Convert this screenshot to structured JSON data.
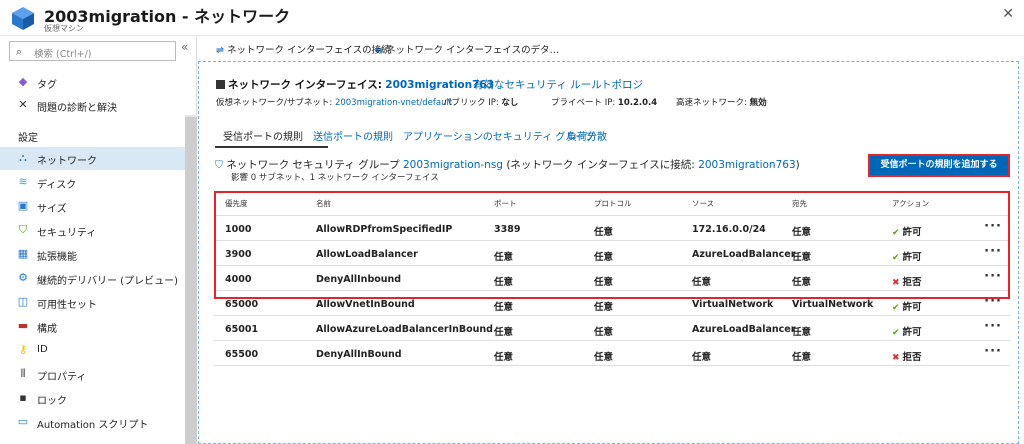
{
  "header": {
    "title": "2003migration - ネットワーク",
    "subtitle": "仮想マシン",
    "logo_icon": "vm-cube-icon",
    "close_icon": "close-icon"
  },
  "sidebar": {
    "search_placeholder": "検索 (Ctrl+/)",
    "collapse_glyph": "«",
    "section_settings": "設定",
    "top_items": [
      {
        "label": "タグ",
        "icon": "tag-icon"
      },
      {
        "label": "問題の診断と解決",
        "icon": "wrench-icon"
      }
    ],
    "items": [
      {
        "label": "ネットワーク",
        "icon": "network-icon",
        "active": true
      },
      {
        "label": "ディスク",
        "icon": "disk-icon"
      },
      {
        "label": "サイズ",
        "icon": "size-icon"
      },
      {
        "label": "セキュリティ",
        "icon": "shield-icon"
      },
      {
        "label": "拡張機能",
        "icon": "extensions-icon"
      },
      {
        "label": "継続的デリバリー (プレビュー)",
        "icon": "delivery-icon"
      },
      {
        "label": "可用性セット",
        "icon": "availability-icon"
      },
      {
        "label": "構成",
        "icon": "config-icon"
      },
      {
        "label": "ID",
        "icon": "key-icon"
      },
      {
        "label": "プロパティ",
        "icon": "properties-icon"
      },
      {
        "label": "ロック",
        "icon": "lock-icon"
      },
      {
        "label": "Automation スクリプト",
        "icon": "script-icon"
      }
    ]
  },
  "commands": [
    {
      "label": "ネットワーク インターフェイスの接続",
      "icon": "attach-icon"
    },
    {
      "label": "ネットワーク インターフェイスのデタ…",
      "icon": "detach-icon"
    }
  ],
  "interface": {
    "prefix": "ネットワーク インターフェイス:",
    "name": "2003migration763",
    "effective_rules": "有効なセキュリティ ルール",
    "topology": "トポロジ",
    "vnet_label": "仮想ネットワーク/サブネット:",
    "vnet_value": "2003migration-vnet/default",
    "public_ip_label": "パブリック IP:",
    "public_ip_value": "なし",
    "private_ip_label": "プライベート IP:",
    "private_ip_value": "10.2.0.4",
    "accel_label": "高速ネットワーク:",
    "accel_value": "無効"
  },
  "tabs": [
    {
      "label": "受信ポートの規則",
      "active": true
    },
    {
      "label": "送信ポートの規則"
    },
    {
      "label": "アプリケーションのセキュリティ グループ"
    },
    {
      "label": "負荷分散"
    }
  ],
  "nsg": {
    "prefix": "ネットワーク セキュリティ グループ",
    "name": "2003migration-nsg",
    "attached_prefix": "(ネットワーク インターフェイスに接続:",
    "attached_name": "2003migration763",
    "attached_suffix": ")",
    "impact": "影響 0 サブネット、1 ネットワーク インターフェイス",
    "icon": "nsg-shield-icon"
  },
  "add_button": "受信ポートの規則を追加する",
  "table": {
    "headers": [
      "優先度",
      "名前",
      "ポート",
      "プロトコル",
      "ソース",
      "宛先",
      "アクション"
    ],
    "rows": [
      {
        "priority": "1000",
        "name": "AllowRDPfromSpecifiedIP",
        "port": "3389",
        "protocol": "任意",
        "source": "172.16.0.0/24",
        "dest": "任意",
        "action": "許可",
        "allow": true
      },
      {
        "priority": "3900",
        "name": "AllowLoadBalancer",
        "port": "任意",
        "protocol": "任意",
        "source": "AzureLoadBalancer",
        "dest": "任意",
        "action": "許可",
        "allow": true
      },
      {
        "priority": "4000",
        "name": "DenyAllInbound",
        "port": "任意",
        "protocol": "任意",
        "source": "任意",
        "dest": "任意",
        "action": "拒否",
        "allow": false
      },
      {
        "priority": "65000",
        "name": "AllowVnetInBound",
        "port": "任意",
        "protocol": "任意",
        "source": "VirtualNetwork",
        "dest": "VirtualNetwork",
        "action": "許可",
        "allow": true
      },
      {
        "priority": "65001",
        "name": "AllowAzureLoadBalancerInBound",
        "port": "任意",
        "protocol": "任意",
        "source": "AzureLoadBalancer",
        "dest": "任意",
        "action": "許可",
        "allow": true
      },
      {
        "priority": "65500",
        "name": "DenyAllInBound",
        "port": "任意",
        "protocol": "任意",
        "source": "任意",
        "dest": "任意",
        "action": "拒否",
        "allow": false
      }
    ],
    "more_glyph": "···"
  },
  "colors": {
    "accent": "#0067b8",
    "highlight": "#e3242b",
    "allow": "#57a300",
    "deny": "#d13438",
    "active_nav": "#d9e8f5"
  }
}
